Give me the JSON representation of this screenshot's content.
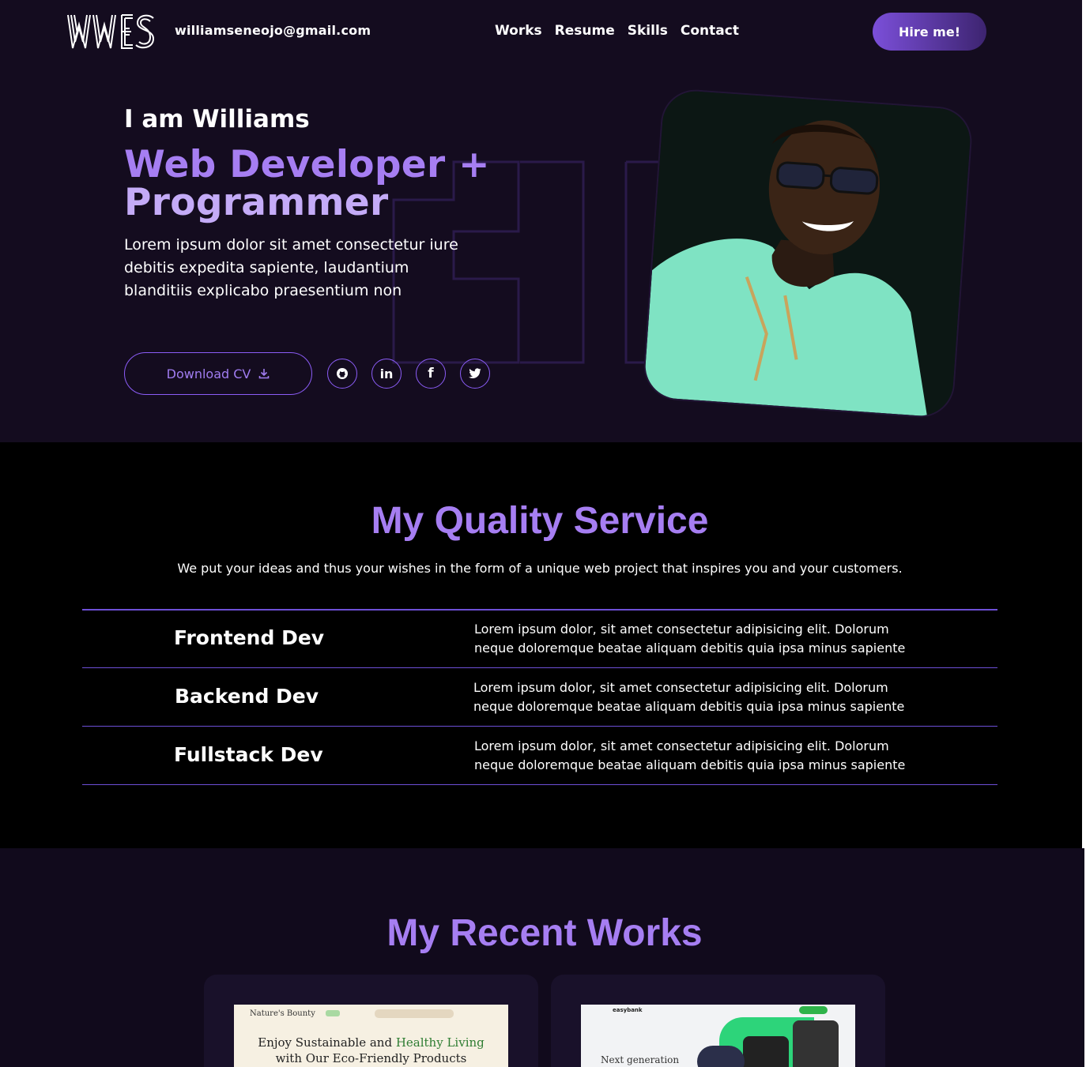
{
  "header": {
    "logo_text": "WES",
    "email": "williamseneojo@gmail.com",
    "menu": [
      "Works",
      "Resume",
      "Skills",
      "Contact"
    ],
    "hire_label": "Hire me!"
  },
  "hero": {
    "intro": "I am Williams",
    "role_line1": "Web Developer +",
    "role_line2": "Programmer",
    "description": "Lorem ipsum dolor sit amet consectetur iure debitis expedita sapiente, laudantium blanditiis explicabo praesentium non",
    "download_label": "Download CV",
    "socials": [
      "github-icon",
      "linkedin-icon",
      "facebook-icon",
      "twitter-icon"
    ],
    "accent": "#a67ef2"
  },
  "service": {
    "title": "My Quality Service",
    "subtitle": "We put your ideas and thus your wishes in the form of a unique web project that inspires you and your customers.",
    "items": [
      {
        "name": "Frontend Dev",
        "text": "Lorem ipsum dolor, sit amet consectetur adipisicing elit. Dolorum neque doloremque beatae aliquam debitis quia ipsa minus sapiente"
      },
      {
        "name": "Backend Dev",
        "text": "Lorem ipsum dolor, sit amet consectetur adipisicing elit. Dolorum neque doloremque beatae aliquam debitis quia ipsa minus sapiente"
      },
      {
        "name": "Fullstack Dev",
        "text": "Lorem ipsum dolor, sit amet consectetur adipisicing elit. Dolorum neque doloremque beatae aliquam debitis quia ipsa minus sapiente"
      }
    ]
  },
  "works": {
    "title": "My Recent Works",
    "card1": {
      "brand": "Nature's Bounty",
      "headline_a": "Enjoy Sustainable and",
      "headline_b": "Healthy Living",
      "headline_c": "with Our Eco-Friendly Products"
    },
    "card2": {
      "brand": "easybank",
      "headline": "Next generation"
    }
  }
}
